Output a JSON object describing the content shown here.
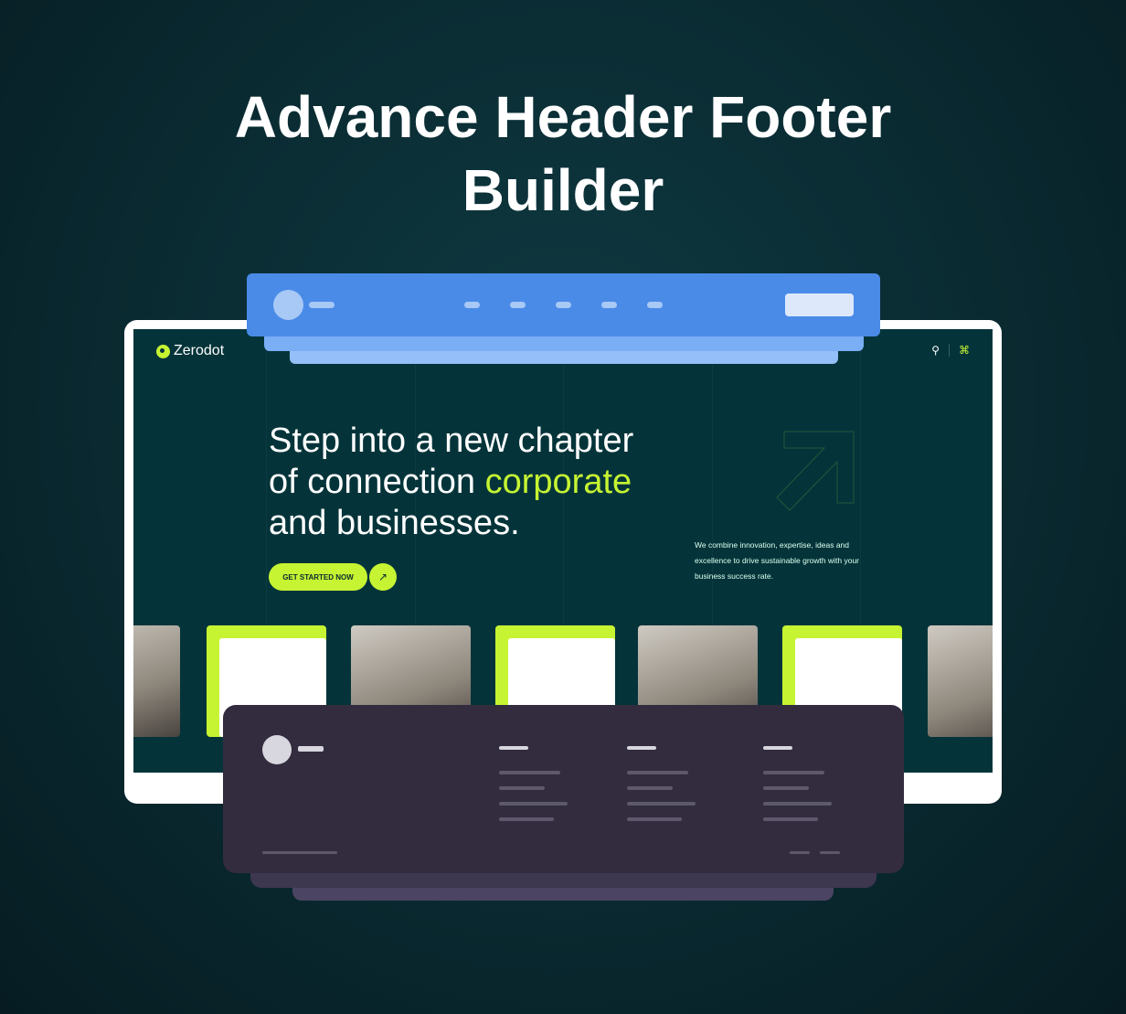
{
  "title_line1": "Advance Header Footer",
  "title_line2": "Builder",
  "site": {
    "logo": "Zerodot",
    "search_icon": "search-icon",
    "apps_icon": "grid-icon",
    "hero": {
      "line1": "Step into a new chapter",
      "line2a": "of connection ",
      "line2b": "corporate",
      "line3": "and businesses."
    },
    "cta_label": "GET STARTED NOW",
    "cta_icon": "arrow-up-right-icon",
    "description": "We combine innovation, expertise, ideas and excellence to drive sustainable growth with your business success rate."
  },
  "colors": {
    "accent": "#c6f432",
    "header_block": "#4a8be8",
    "footer_block": "#322c3e",
    "screen": "#04343a"
  }
}
